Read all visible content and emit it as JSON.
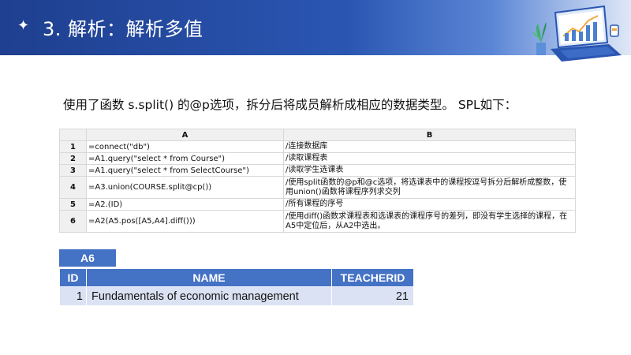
{
  "header": {
    "title": "3. 解析：解析多值"
  },
  "intro": "使用了函数 s.split() 的@p选项，拆分后将成员解析成相应的数据类型。 SPL如下：",
  "grid": {
    "col_a": "A",
    "col_b": "B",
    "rows": [
      {
        "n": "1",
        "a": "=connect(\"db\")",
        "b": "/连接数据库"
      },
      {
        "n": "2",
        "a": "=A1.query(\"select * from Course\")",
        "b": "/读取课程表"
      },
      {
        "n": "3",
        "a": "=A1.query(\"select * from SelectCourse\")",
        "b": "/读取学生选课表"
      },
      {
        "n": "4",
        "a": "=A3.union(COURSE.split@cp())",
        "b": "/使用split函数的@p和@c选项，将选课表中的课程按逗号拆分后解析成整数，使用union()函数将课程序列求交列"
      },
      {
        "n": "5",
        "a": "=A2.(ID)",
        "b": "/所有课程的序号"
      },
      {
        "n": "6",
        "a": "=A2(A5.pos([A5,A4].diff()))",
        "b": "/使用diff()函数求课程表和选课表的课程序号的差列，即没有学生选择的课程，在A5中定位后，从A2中选出。"
      }
    ]
  },
  "result": {
    "label": "A6",
    "headers": [
      "ID",
      "NAME",
      "TEACHERID"
    ],
    "row": {
      "id": "1",
      "name": "Fundamentals of economic management",
      "teacherid": "21"
    }
  },
  "colors": {
    "header_blue": "#2a56b2",
    "table_header": "#4472c4",
    "table_row": "#dbe2f3"
  },
  "icons": [
    "sparkle-icon",
    "laptop-chart-illustration"
  ]
}
